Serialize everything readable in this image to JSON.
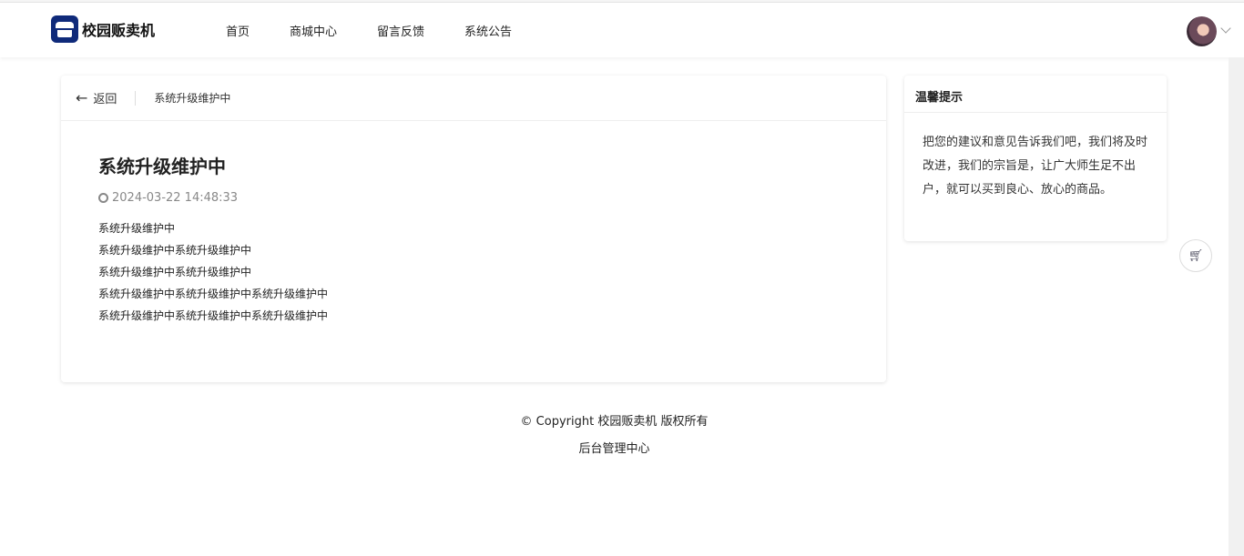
{
  "header": {
    "brand": "校园贩卖机",
    "nav": [
      "首页",
      "商城中心",
      "留言反馈",
      "系统公告"
    ]
  },
  "breadcrumb": {
    "back": "返回",
    "current": "系统升级维护中"
  },
  "article": {
    "title": "系统升级维护中",
    "time": "2024-03-22 14:48:33",
    "lines": [
      "系统升级维护中",
      "系统升级维护中系统升级维护中",
      "系统升级维护中系统升级维护中",
      "系统升级维护中系统升级维护中系统升级维护中",
      "系统升级维护中系统升级维护中系统升级维护中"
    ]
  },
  "tip": {
    "title": "温馨提示",
    "text": "把您的建议和意见告诉我们吧，我们将及时改进，我们的宗旨是，让广大师生足不出户，就可以买到良心、放心的商品。"
  },
  "footer": {
    "copyright": "© Copyright 校园贩卖机 版权所有",
    "admin": "后台管理中心"
  }
}
